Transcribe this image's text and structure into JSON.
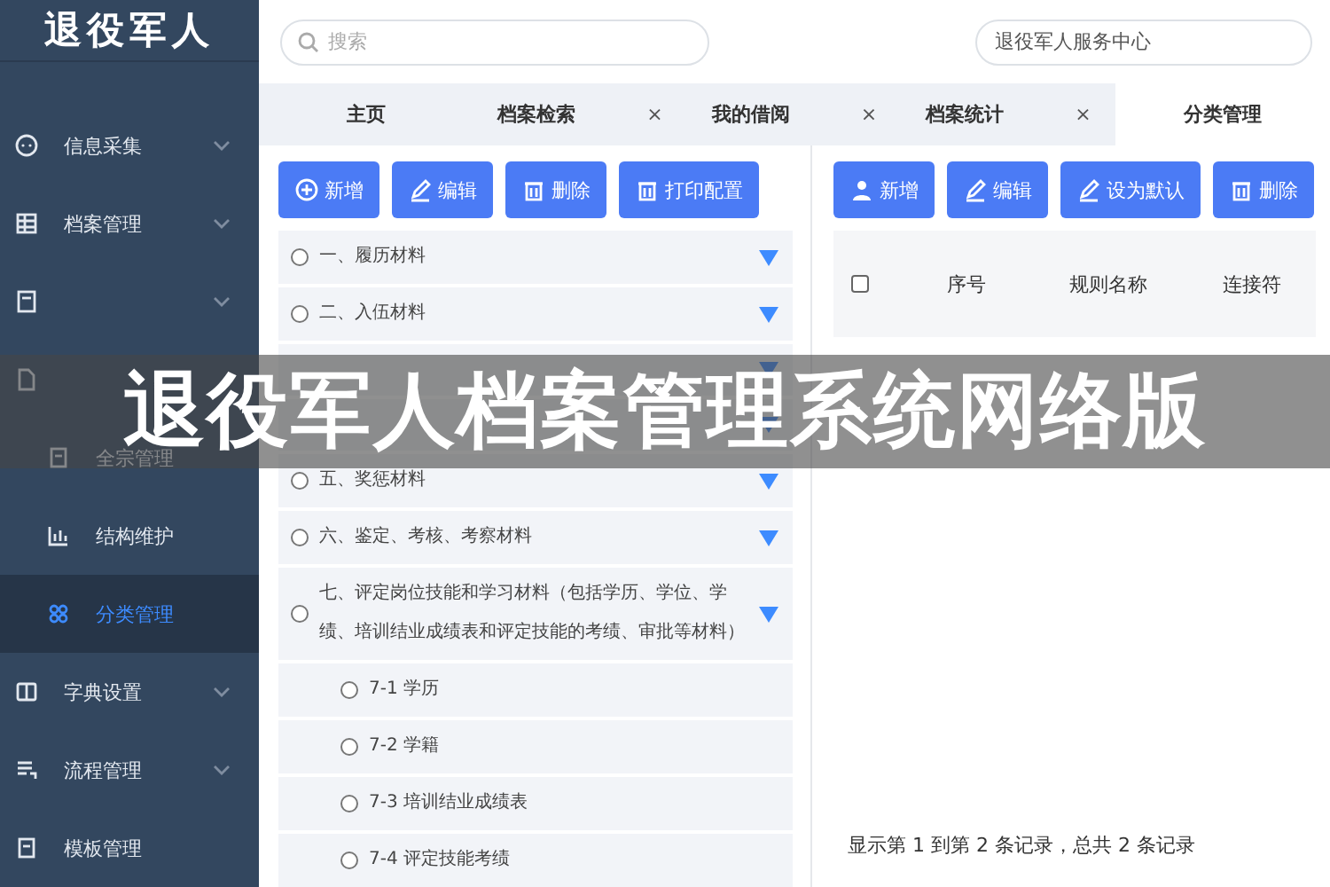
{
  "sidebar": {
    "logo": "退役军人",
    "items": [
      {
        "kind": "group",
        "label": "信息采集",
        "selected": false
      },
      {
        "kind": "group",
        "label": "档案管理",
        "selected": false
      },
      {
        "kind": "group",
        "selected": false
      },
      {
        "kind": "leaf",
        "selected": false
      },
      {
        "kind": "sub",
        "label": "全宗管理",
        "selected": false
      },
      {
        "kind": "sub",
        "label": "结构维护",
        "selected": false
      },
      {
        "kind": "sub",
        "label": "分类管理",
        "selected": true
      },
      {
        "kind": "group",
        "label": "字典设置",
        "selected": false
      },
      {
        "kind": "group",
        "label": "流程管理",
        "selected": false
      },
      {
        "kind": "leaf",
        "label": "模板管理",
        "selected": false
      }
    ]
  },
  "topbar": {
    "search": {
      "placeholder": "搜索"
    },
    "org": {
      "value": "退役军人服务中心"
    }
  },
  "tabs": [
    {
      "kind": "fixed",
      "label": "主页",
      "selected": false
    },
    {
      "kind": "closable",
      "label": "档案检索",
      "selected": false
    },
    {
      "kind": "closable",
      "label": "我的借阅",
      "selected": false
    },
    {
      "kind": "closable",
      "label": "档案统计",
      "selected": false
    },
    {
      "kind": "fixed",
      "label": "分类管理",
      "selected": true
    }
  ],
  "close_mark": "×",
  "left_panel": {
    "buttons": [
      "新增",
      "编辑",
      "删除",
      "打印配置"
    ],
    "tree": [
      {
        "label": "一、履历材料",
        "selected": false,
        "expanded": true
      },
      {
        "label": "二、入伍材料",
        "selected": false,
        "expanded": true
      },
      {
        "expanded": true
      },
      {
        "expanded": true
      },
      {
        "label": "五、奖惩材料",
        "selected": false,
        "expanded": true
      },
      {
        "label": "六、鉴定、考核、考察材料",
        "selected": false,
        "expanded": true
      },
      {
        "label": "七、评定岗位技能和学习材料（包括学历、学位、学绩、培训结业成绩表和评定技能的考绩、审批等材料）",
        "selected": false,
        "expanded": true,
        "children": [
          {
            "label": "7-1  学历",
            "selected": false
          },
          {
            "label": "7-2  学籍",
            "selected": false
          },
          {
            "label": "7-3  培训结业成绩表",
            "selected": false
          },
          {
            "label": "7-4  评定技能考绩",
            "selected": false
          }
        ]
      }
    ]
  },
  "right_panel": {
    "buttons": [
      "新增",
      "编辑",
      "设为默认",
      "删除"
    ],
    "table": {
      "select_all": {
        "checked": false
      },
      "columns": [
        "序号",
        "规则名称",
        "连接符"
      ]
    },
    "footer": "显示第 1 到第 2 条记录，总共 2 条记录"
  },
  "banner": {
    "title": "退役军人档案管理系统网络版"
  }
}
